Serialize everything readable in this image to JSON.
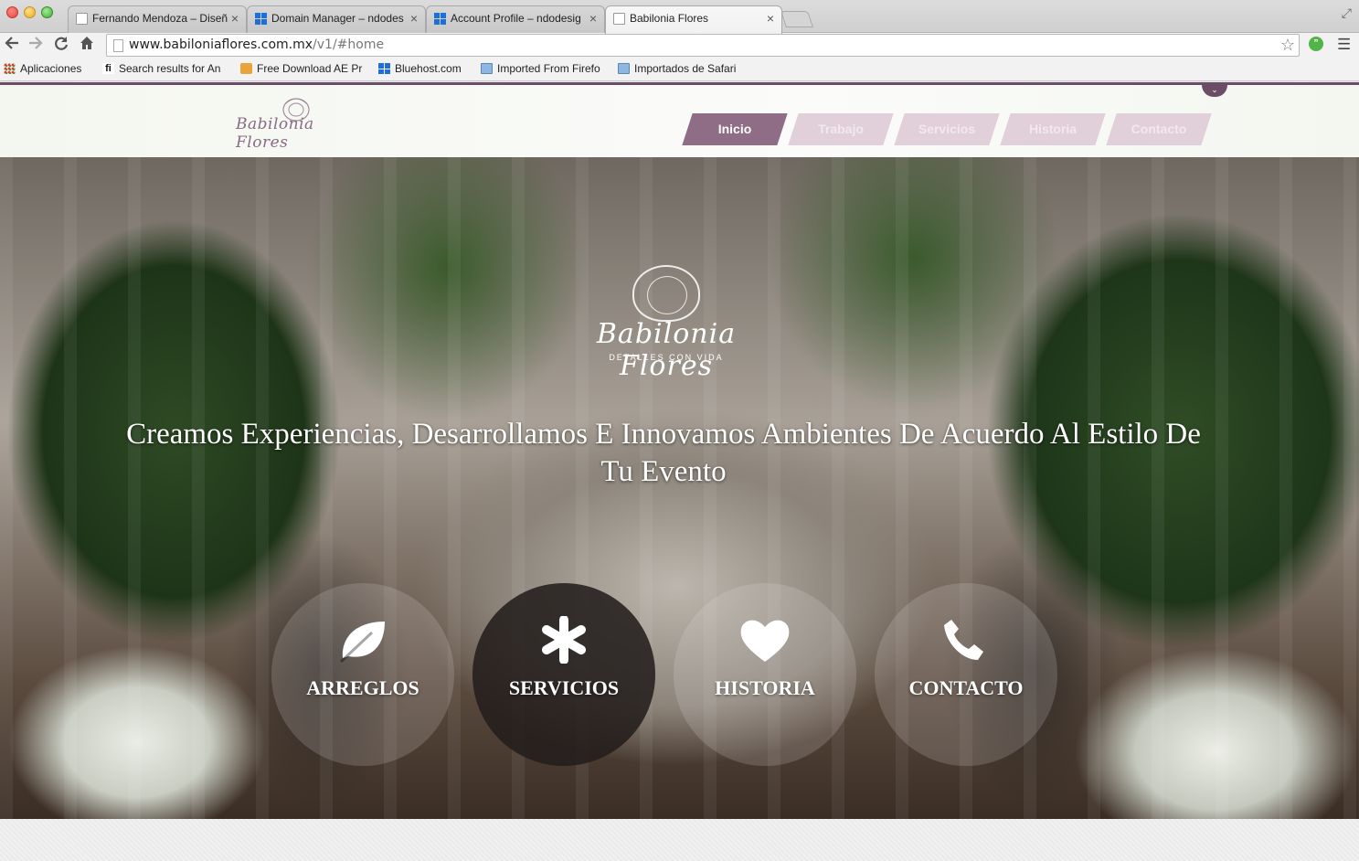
{
  "browser": {
    "tabs": [
      {
        "title": "Fernando Mendoza – Diseñ",
        "favicon": "blank-page-icon",
        "active": false
      },
      {
        "title": "Domain Manager – ndodes",
        "favicon": "grid-icon",
        "active": false
      },
      {
        "title": "Account Profile – ndodesig",
        "favicon": "grid-icon",
        "active": false
      },
      {
        "title": "Babilonia Flores",
        "favicon": "blank-page-icon",
        "active": true
      }
    ],
    "url_host": "www.babiloniaflores.com.mx",
    "url_path": "/v1/#home",
    "bookmarks": [
      {
        "label": "Aplicaciones",
        "icon": "apps-icon"
      },
      {
        "label": "Search results for An",
        "icon": "fi-icon"
      },
      {
        "label": "Free Download AE Pr",
        "icon": "ae-icon"
      },
      {
        "label": "Bluehost.com",
        "icon": "grid-icon"
      },
      {
        "label": "Imported From Firefo",
        "icon": "folder-icon"
      },
      {
        "label": "Importados de Safari",
        "icon": "folder-icon"
      }
    ]
  },
  "site": {
    "logo_text": "Babilonia Flores",
    "nav": [
      {
        "label": "Inicio",
        "active": true
      },
      {
        "label": "Trabajo",
        "active": false
      },
      {
        "label": "Servicios",
        "active": false
      },
      {
        "label": "Historia",
        "active": false
      },
      {
        "label": "Contacto",
        "active": false
      }
    ],
    "hero": {
      "logo_text": "Babilonia Flores",
      "tagline": "DETALLES CON VIDA",
      "headline": "Creamos Experiencias, Desarrollamos E Innovamos Ambientes De Acuerdo Al Estilo De Tu Evento"
    },
    "features": [
      {
        "label": "ARREGLOS",
        "icon": "leaf-icon",
        "highlight": false
      },
      {
        "label": "SERVICIOS",
        "icon": "asterisk-icon",
        "highlight": true
      },
      {
        "label": "HISTORIA",
        "icon": "heart-icon",
        "highlight": false
      },
      {
        "label": "CONTACTO",
        "icon": "phone-icon",
        "highlight": false
      }
    ],
    "colors": {
      "brand": "#8f6d86",
      "nav_inactive": "#e1cfd9",
      "topbar": "#6b4d66"
    }
  }
}
